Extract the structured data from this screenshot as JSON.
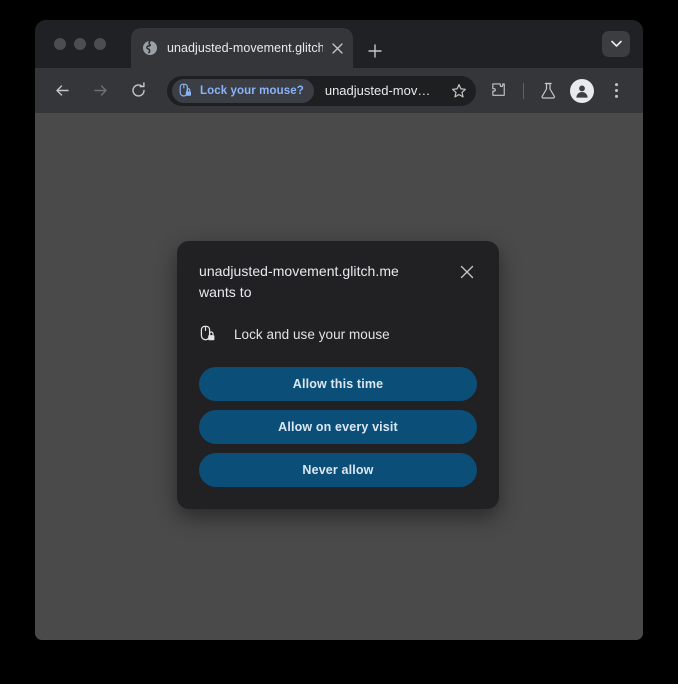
{
  "window": {
    "traffic_lights": [
      "close-button",
      "minimize-button",
      "maximize-button"
    ]
  },
  "tabstrip": {
    "tab": {
      "favicon": "globe-icon",
      "title": "unadjusted-movement.glitch.",
      "close_label": "×"
    },
    "new_tab_label": "+",
    "tab_search_label": "⌄"
  },
  "toolbar": {
    "back_label": "←",
    "forward_label": "→",
    "reload_label": "↻",
    "permission_chip": {
      "icon": "mouse-lock-icon",
      "label": "Lock your mouse?"
    },
    "url": "unadjusted-mov…",
    "bookmark_label": "☆",
    "extensions_label": "extensions-icon",
    "experiments_label": "flask-icon",
    "profile_label": "profile-avatar-icon",
    "menu_label": "⋮"
  },
  "dialog": {
    "title": "unadjusted-movement.glitch.me wants to",
    "close_label": "×",
    "request_icon": "mouse-lock-icon",
    "request_label": "Lock and use your mouse",
    "buttons": [
      {
        "label": "Allow this time",
        "name": "allow-this-time-button"
      },
      {
        "label": "Allow on every visit",
        "name": "allow-every-visit-button"
      },
      {
        "label": "Never allow",
        "name": "never-allow-button"
      }
    ]
  },
  "colors": {
    "button_blue": "#0b4e78",
    "chip_text": "#8ab4f8",
    "page_background": "#4a4a4a",
    "dialog_background": "#212124",
    "toolbar_background": "#35363a",
    "tabstrip_background": "#202124"
  }
}
